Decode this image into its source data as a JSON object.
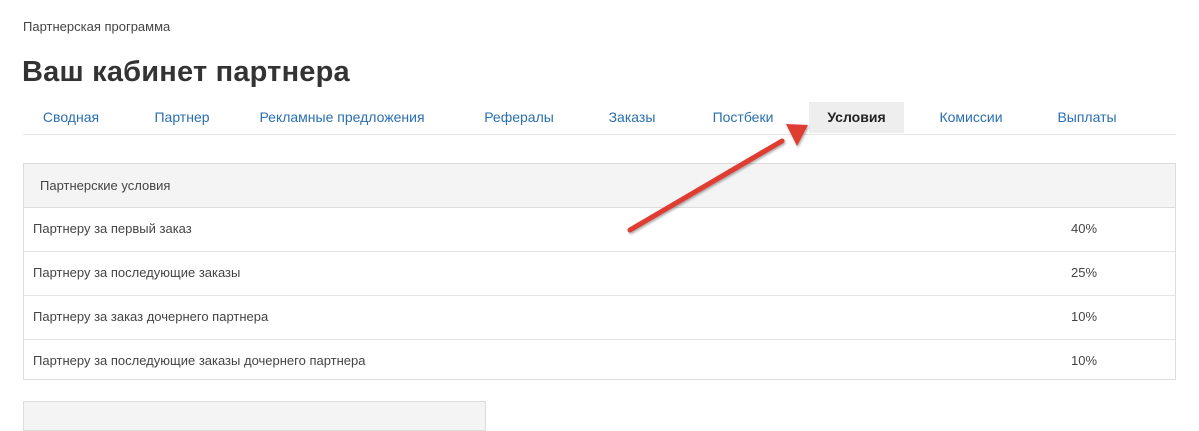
{
  "breadcrumb": "Партнерская программа",
  "title": "Ваш кабинет партнера",
  "tabs": [
    {
      "label": "Сводная",
      "active": false
    },
    {
      "label": "Партнер",
      "active": false
    },
    {
      "label": "Рекламные предложения",
      "active": false
    },
    {
      "label": "Рефералы",
      "active": false
    },
    {
      "label": "Заказы",
      "active": false
    },
    {
      "label": "Постбеки",
      "active": false
    },
    {
      "label": "Условия",
      "active": true
    },
    {
      "label": "Комиссии",
      "active": false
    },
    {
      "label": "Выплаты",
      "active": false
    }
  ],
  "terms": {
    "heading": "Партнерские условия",
    "rows": [
      {
        "label": "Партнеру за первый заказ",
        "value": "40%"
      },
      {
        "label": "Партнеру за последующие заказы",
        "value": "25%"
      },
      {
        "label": "Партнеру за заказ дочернего партнера",
        "value": "10%"
      },
      {
        "label": "Партнеру за последующие заказы дочернего партнера",
        "value": "10%"
      }
    ]
  },
  "colors": {
    "link": "#2a6fb0",
    "active_tab_bg": "#eeeeee",
    "annotation_arrow": "#e03c31"
  },
  "annotation": {
    "icon": "red-arrow-icon"
  }
}
